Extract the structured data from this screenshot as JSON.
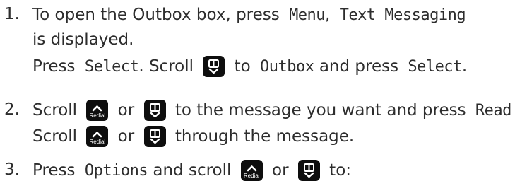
{
  "steps": [
    {
      "number": "1.",
      "line1": {
        "text_a": "To open the Outbox box, press ",
        "menu": "Menu",
        "comma": ", ",
        "text_messaging": "Text Messaging"
      },
      "line2": {
        "text": "is displayed."
      },
      "line3": {
        "press": "Press ",
        "select1": "Select",
        "scroll": ". Scroll ",
        "to": " to ",
        "outbox": "Outbox",
        "and_press": " and press ",
        "select2": "Select",
        "period": "."
      }
    },
    {
      "number": "2.",
      "line1": {
        "scroll": "Scroll ",
        "or": " or ",
        "rest": " to the message you want and press ",
        "read": "Read"
      },
      "line2": {
        "scroll": "Scroll ",
        "or": " or ",
        "rest": " through the message."
      }
    },
    {
      "number": "3.",
      "line1": {
        "press": "Press ",
        "options": "Options",
        "scroll": " and scroll ",
        "or": " or ",
        "to": " to:"
      }
    }
  ],
  "keys": {
    "redial_label": "Redial",
    "up_icon": "chevron-up-icon",
    "down_icon": "phonebook-down-icon"
  }
}
